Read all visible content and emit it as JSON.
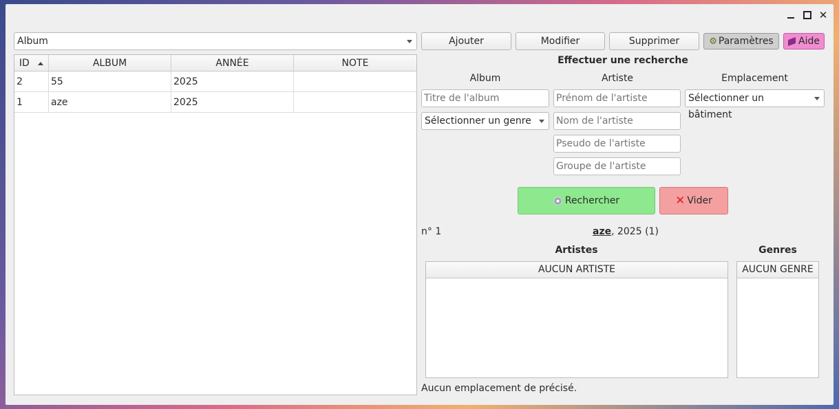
{
  "window": {
    "controls": {
      "minimize": "_",
      "maximize": "□",
      "close": "✕"
    }
  },
  "toolbar": {
    "type_select": "Album",
    "add": "Ajouter",
    "edit": "Modifier",
    "delete": "Supprimer",
    "settings": "Paramètres",
    "help": "Aide"
  },
  "table": {
    "columns": [
      "ID",
      "ALBUM",
      "ANNÉE",
      "NOTE"
    ],
    "rows": [
      [
        "2",
        "55",
        "2025",
        ""
      ],
      [
        "1",
        "aze",
        "2025",
        ""
      ]
    ]
  },
  "search": {
    "title": "Effectuer une recherche",
    "col_album": "Album",
    "col_artist": "Artiste",
    "col_location": "Emplacement",
    "album_title_placeholder": "Titre de l'album",
    "genre_select": "Sélectionner un genre",
    "artist_firstname_placeholder": "Prénom de l'artiste",
    "artist_lastname_placeholder": "Nom de l'artiste",
    "artist_pseudo_placeholder": "Pseudo de l'artiste",
    "artist_group_placeholder": "Groupe de l'artiste",
    "building_select": "Sélectionner un bâtiment",
    "search_button": "Rechercher",
    "clear_button": "Vider"
  },
  "detail": {
    "number": "n° 1",
    "album_name": "aze",
    "album_suffix": ", 2025 (1)",
    "artists_title": "Artistes",
    "genres_title": "Genres",
    "artists_header": "AUCUN ARTISTE",
    "genres_header": "AUCUN GENRE",
    "location_text": "Aucun emplacement de précisé."
  },
  "colors": {
    "search_green": "#8ee88e",
    "clear_red": "#f4a0a0",
    "help_pink": "#f08cd0",
    "settings_gray": "#cfcfcf"
  }
}
